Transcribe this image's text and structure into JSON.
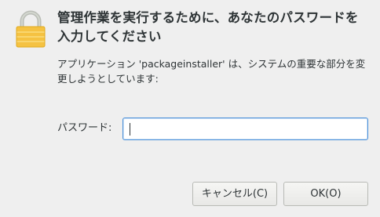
{
  "dialog": {
    "title": "管理作業を実行するために、あなたのパスワードを入力してください",
    "message": "アプリケーション 'packageinstaller' は、システムの重要な部分を変更しようとしています:",
    "password": {
      "label": "パスワード:",
      "value": ""
    },
    "buttons": {
      "cancel_label": "キャンセル(C)",
      "ok_label": "OK(O)"
    },
    "icon": "lock-icon",
    "colors": {
      "lock_body": "#f5c242",
      "lock_shackle": "#babdb6",
      "focus": "#4a90d9"
    }
  }
}
